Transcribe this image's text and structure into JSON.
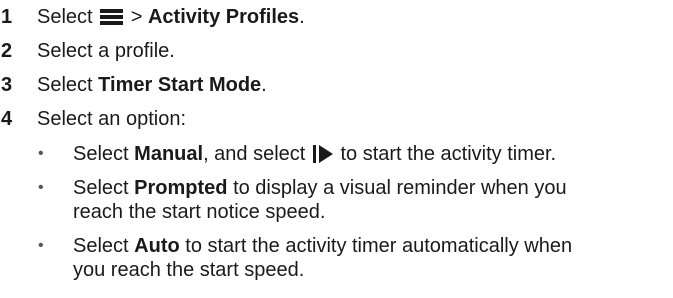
{
  "steps": [
    {
      "number": "1",
      "pre": "Select",
      "mid": ">",
      "bold": "Activity Profiles",
      "post": "."
    },
    {
      "number": "2",
      "text": "Select a profile."
    },
    {
      "number": "3",
      "pre": "Select",
      "bold": "Timer Start Mode",
      "post": "."
    },
    {
      "number": "4",
      "text": "Select an option:"
    }
  ],
  "bullets": [
    {
      "pre": "Select",
      "bold": "Manual",
      "mid": ", and select",
      "post": "to start the activity timer."
    },
    {
      "pre": "Select",
      "bold": "Prompted",
      "line1": "to display a visual reminder when you",
      "line2": "reach the start notice speed."
    },
    {
      "pre": "Select",
      "bold": "Auto",
      "line1": "to start the activity timer automatically when",
      "line2": "you reach the start speed."
    }
  ],
  "bullet_symbol": "•",
  "icons": {
    "menu": "menu-icon",
    "start": "play-pause-icon"
  }
}
